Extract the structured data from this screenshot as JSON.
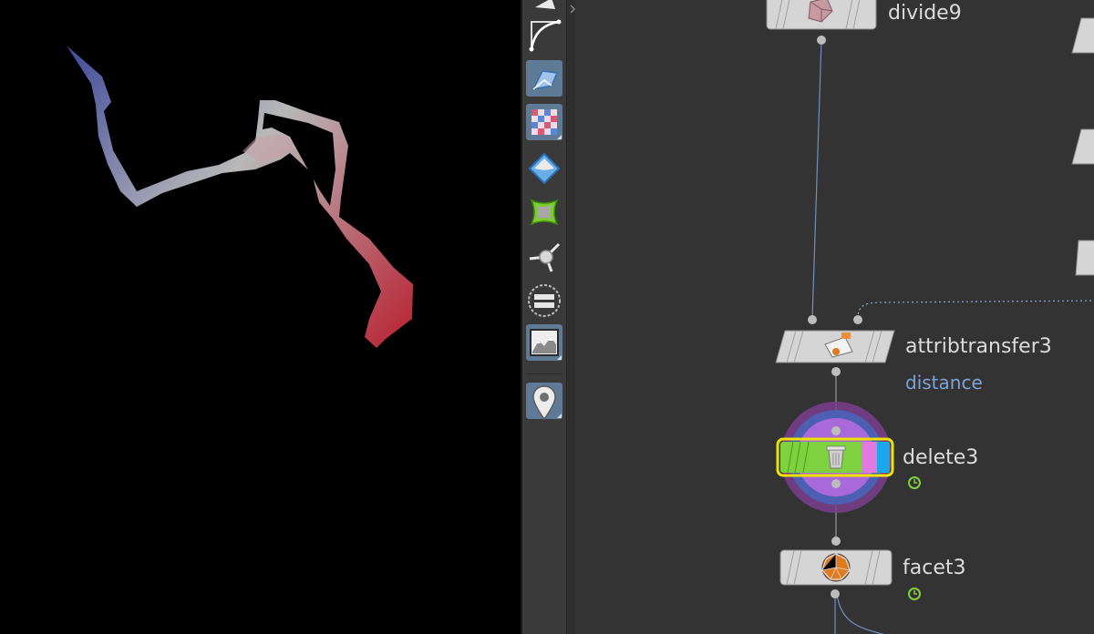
{
  "network": {
    "nodes": {
      "divide9": {
        "label": "divide9"
      },
      "attribtransfer3": {
        "label": "attribtransfer3",
        "comment": "distance"
      },
      "delete3": {
        "label": "delete3"
      },
      "facet3": {
        "label": "facet3"
      }
    }
  },
  "colors": {
    "network_bg": "#333333",
    "node_body": "#d5d5d5",
    "delete_node_fill": "#7fd13f",
    "delete_node_pink": "#e07ae0",
    "delete_node_blue": "#1ba8e8",
    "selection_outline": "#f0e000",
    "comment_text": "#7ea3d9",
    "wire_color": "#6f8fbf",
    "ribbon_start": "#3e4a9a",
    "ribbon_mid": "#b8b8b8",
    "ribbon_end": "#b82030"
  },
  "shelf": {
    "tools": [
      {
        "icon": "curve-tool-icon"
      },
      {
        "icon": "polygon-draw-icon",
        "selected": true
      },
      {
        "icon": "uv-checker-icon",
        "selected": true
      },
      {
        "icon": "diamond-shape-icon"
      },
      {
        "icon": "green-patch-icon"
      },
      {
        "icon": "transform-handle-icon"
      },
      {
        "icon": "equals-circle-icon"
      },
      {
        "icon": "terrain-image-icon",
        "selected": true
      },
      {
        "icon": "location-pin-icon",
        "selected": true
      }
    ]
  }
}
